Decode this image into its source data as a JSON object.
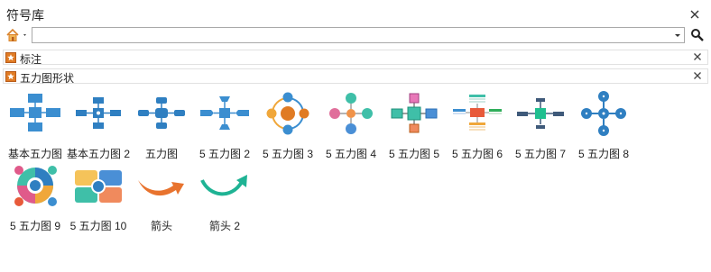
{
  "panel": {
    "title": "符号库",
    "search": {
      "value": "",
      "placeholder": ""
    }
  },
  "categories": [
    {
      "label": "标注",
      "icon": "star-folder-icon"
    },
    {
      "label": "五力图形状",
      "icon": "star-folder-icon"
    }
  ],
  "shapes": [
    {
      "label": "基本五力图",
      "icon": "basic-five-forces-icon"
    },
    {
      "label": "基本五力图 2",
      "icon": "basic-five-forces-2-icon"
    },
    {
      "label": "五力图",
      "icon": "five-forces-icon"
    },
    {
      "label": "5 五力图 2",
      "icon": "five-forces-2-icon"
    },
    {
      "label": "5 五力图 3",
      "icon": "five-forces-3-icon"
    },
    {
      "label": "5 五力图 4",
      "icon": "five-forces-4-icon"
    },
    {
      "label": "5 五力图 5",
      "icon": "five-forces-5-icon"
    },
    {
      "label": "5 五力图 6",
      "icon": "five-forces-6-icon"
    },
    {
      "label": "5 五力图 7",
      "icon": "five-forces-7-icon"
    },
    {
      "label": "5 五力图 8",
      "icon": "five-forces-8-icon"
    },
    {
      "label": "5 五力图 9",
      "icon": "five-forces-9-icon"
    },
    {
      "label": "5 五力图 10",
      "icon": "five-forces-10-icon"
    },
    {
      "label": "箭头",
      "icon": "arrow-icon"
    },
    {
      "label": "箭头 2",
      "icon": "arrow-2-icon"
    }
  ]
}
